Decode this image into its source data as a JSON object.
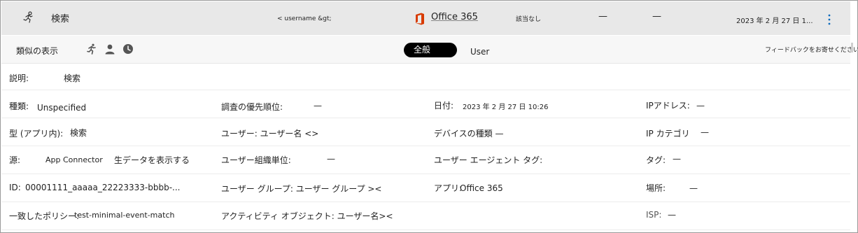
{
  "header": {
    "title": "検索",
    "user_value": "< username &gt;",
    "app_name": "Office 365",
    "risk": "該当なし",
    "dash1": "—",
    "dash2": "—",
    "date": "2023 年 2 月 27 日 1..."
  },
  "toolbar": {
    "similar_label": "類似の表示",
    "tab_general": "全般",
    "tab_user": "User",
    "feedback": "フィードバックをお寄せください。"
  },
  "details": {
    "description_label": "説明:",
    "description_value": "検索",
    "type_label": "種類:",
    "type_value": "Unspecified",
    "priority_label": "調査の優先順位:",
    "priority_value": "—",
    "date_label": "日付:",
    "date_value": "2023 年 2 月 27 日 10:26",
    "ip_label": "IPアドレス:",
    "ip_value": "—",
    "inapp_type_label": "型 (アプリ内):",
    "inapp_type_value": "検索",
    "user_label": "ユーザー: ユーザー名 <>",
    "device_label": "デバイスの種類 —",
    "ip_category_label": "IP カテゴリ",
    "ip_category_value": "—",
    "source_label": "源:",
    "source_value": "App Connector",
    "raw_data_link": "生データを表示する",
    "org_unit_label": "ユーザー組織単位:",
    "org_unit_value": "—",
    "user_agent_label": "ユーザー エージェント タグ:",
    "tags_label": "タグ:",
    "tags_value": "—",
    "id_label": "ID:",
    "id_value": "00001111_aaaaa_22223333-bbbb-...",
    "user_groups_label": "ユーザー グループ: ユーザー グループ ><",
    "app_label": "アプリ:",
    "app_value": "Office 365",
    "location_label": "場所:",
    "location_value": "—",
    "policy_label": "一致したポリシー:",
    "policy_value": "test-minimal-event-match",
    "activity_object_label": "アクティビティ オブジェクト: ユーザー名><",
    "isp_label": "ISP:",
    "isp_value": "—"
  },
  "icons": [
    "activity-run-icon",
    "office-logo-icon",
    "more-vertical-icon",
    "running-person-icon",
    "person-icon",
    "clock-icon"
  ],
  "colors": {
    "header_bg": "#e8e8e8",
    "office_orange": "#d83b01",
    "more_blue": "#0f6cbd",
    "pill_bg": "#000000"
  }
}
